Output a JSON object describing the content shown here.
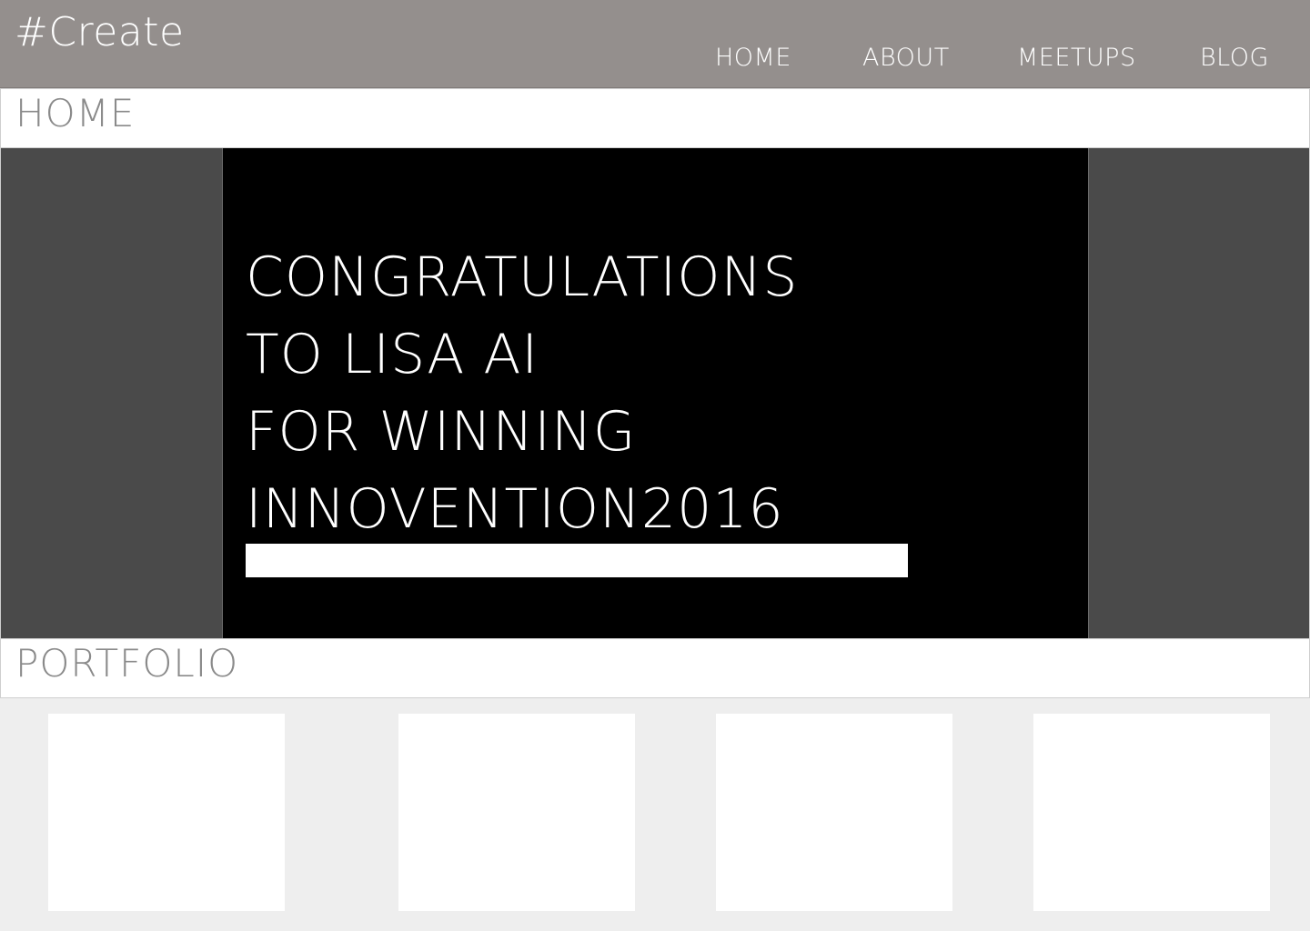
{
  "brand": "#Create",
  "nav": {
    "home": "HOME",
    "about": "ABOUT",
    "meetups": "MEETUPS",
    "blog": "BLOG"
  },
  "sections": {
    "home_title": "HOME",
    "portfolio_title": "PORTFOLIO"
  },
  "hero": {
    "lines": [
      "CONGRATULATIONS",
      "TO LISA AI",
      "FOR WINNING",
      "INNOVENTION2016"
    ]
  },
  "colors": {
    "topbar": "#948f8d",
    "hero_side": "#4a4a4a",
    "hero_panel": "#000000",
    "portfolio_bg": "#eeeeee",
    "section_title": "#8a8a8a"
  }
}
